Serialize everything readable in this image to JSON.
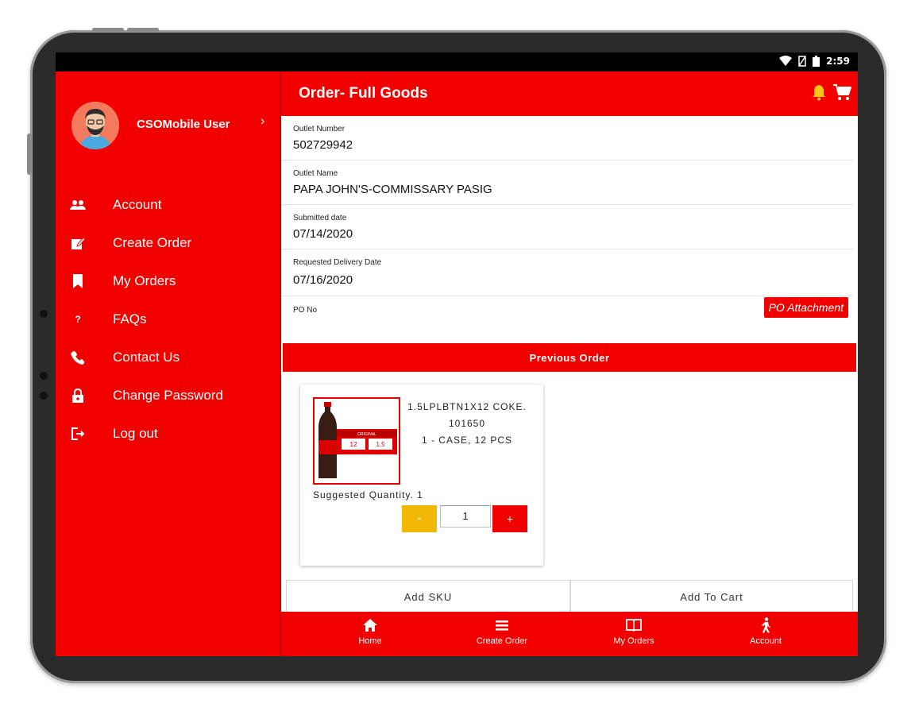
{
  "status_bar": {
    "time": "2:59",
    "icons": [
      "wifi-icon",
      "signal-icon",
      "battery-icon"
    ]
  },
  "drawer": {
    "user_name": "CSOMobile User",
    "items": [
      {
        "label": "Account",
        "icon": "users-icon"
      },
      {
        "label": "Create Order",
        "icon": "edit-icon"
      },
      {
        "label": "My Orders",
        "icon": "bookmark-icon"
      },
      {
        "label": "FAQs",
        "icon": "question-icon"
      },
      {
        "label": "Contact Us",
        "icon": "phone-icon"
      },
      {
        "label": "Change Password",
        "icon": "lock-icon"
      },
      {
        "label": "Log out",
        "icon": "logout-icon"
      }
    ]
  },
  "header": {
    "title": "Order- Full Goods"
  },
  "fields": {
    "outlet_number": {
      "label": "Outlet Number",
      "value": "502729942"
    },
    "outlet_name": {
      "label": "Outlet Name",
      "value": "PAPA JOHN'S-COMMISSARY PASIG"
    },
    "submitted_date": {
      "label": "Submitted date",
      "value": "07/14/2020"
    },
    "delivery_date": {
      "label": "Requested Delivery Date",
      "value": "07/16/2020"
    },
    "po_no": {
      "label": "PO No"
    }
  },
  "po_attachment_label": "PO Attachment",
  "previous_order_label": "Previous Order",
  "product": {
    "name": "1.5LPLBTN1X12 COKE.",
    "code": "101650",
    "pack": "1 - CASE, 12 PCS",
    "suggested": "Suggested Quantity. 1",
    "quantity": "1",
    "minus_label": "-",
    "plus_label": "+",
    "image_text": {
      "band": "ORIGINAL",
      "left": "12",
      "right": "1.5"
    }
  },
  "actions": {
    "add_sku": "Add SKU",
    "add_to_cart": "Add To Cart"
  },
  "bottom_nav": [
    {
      "label": "Home",
      "icon": "home-icon"
    },
    {
      "label": "Create Order",
      "icon": "list-icon"
    },
    {
      "label": "My Orders",
      "icon": "book-icon"
    },
    {
      "label": "Account",
      "icon": "walking-person-icon"
    }
  ],
  "colors": {
    "primary": "#f20000",
    "accent_yellow": "#f2b705",
    "bell": "#f5c518"
  }
}
